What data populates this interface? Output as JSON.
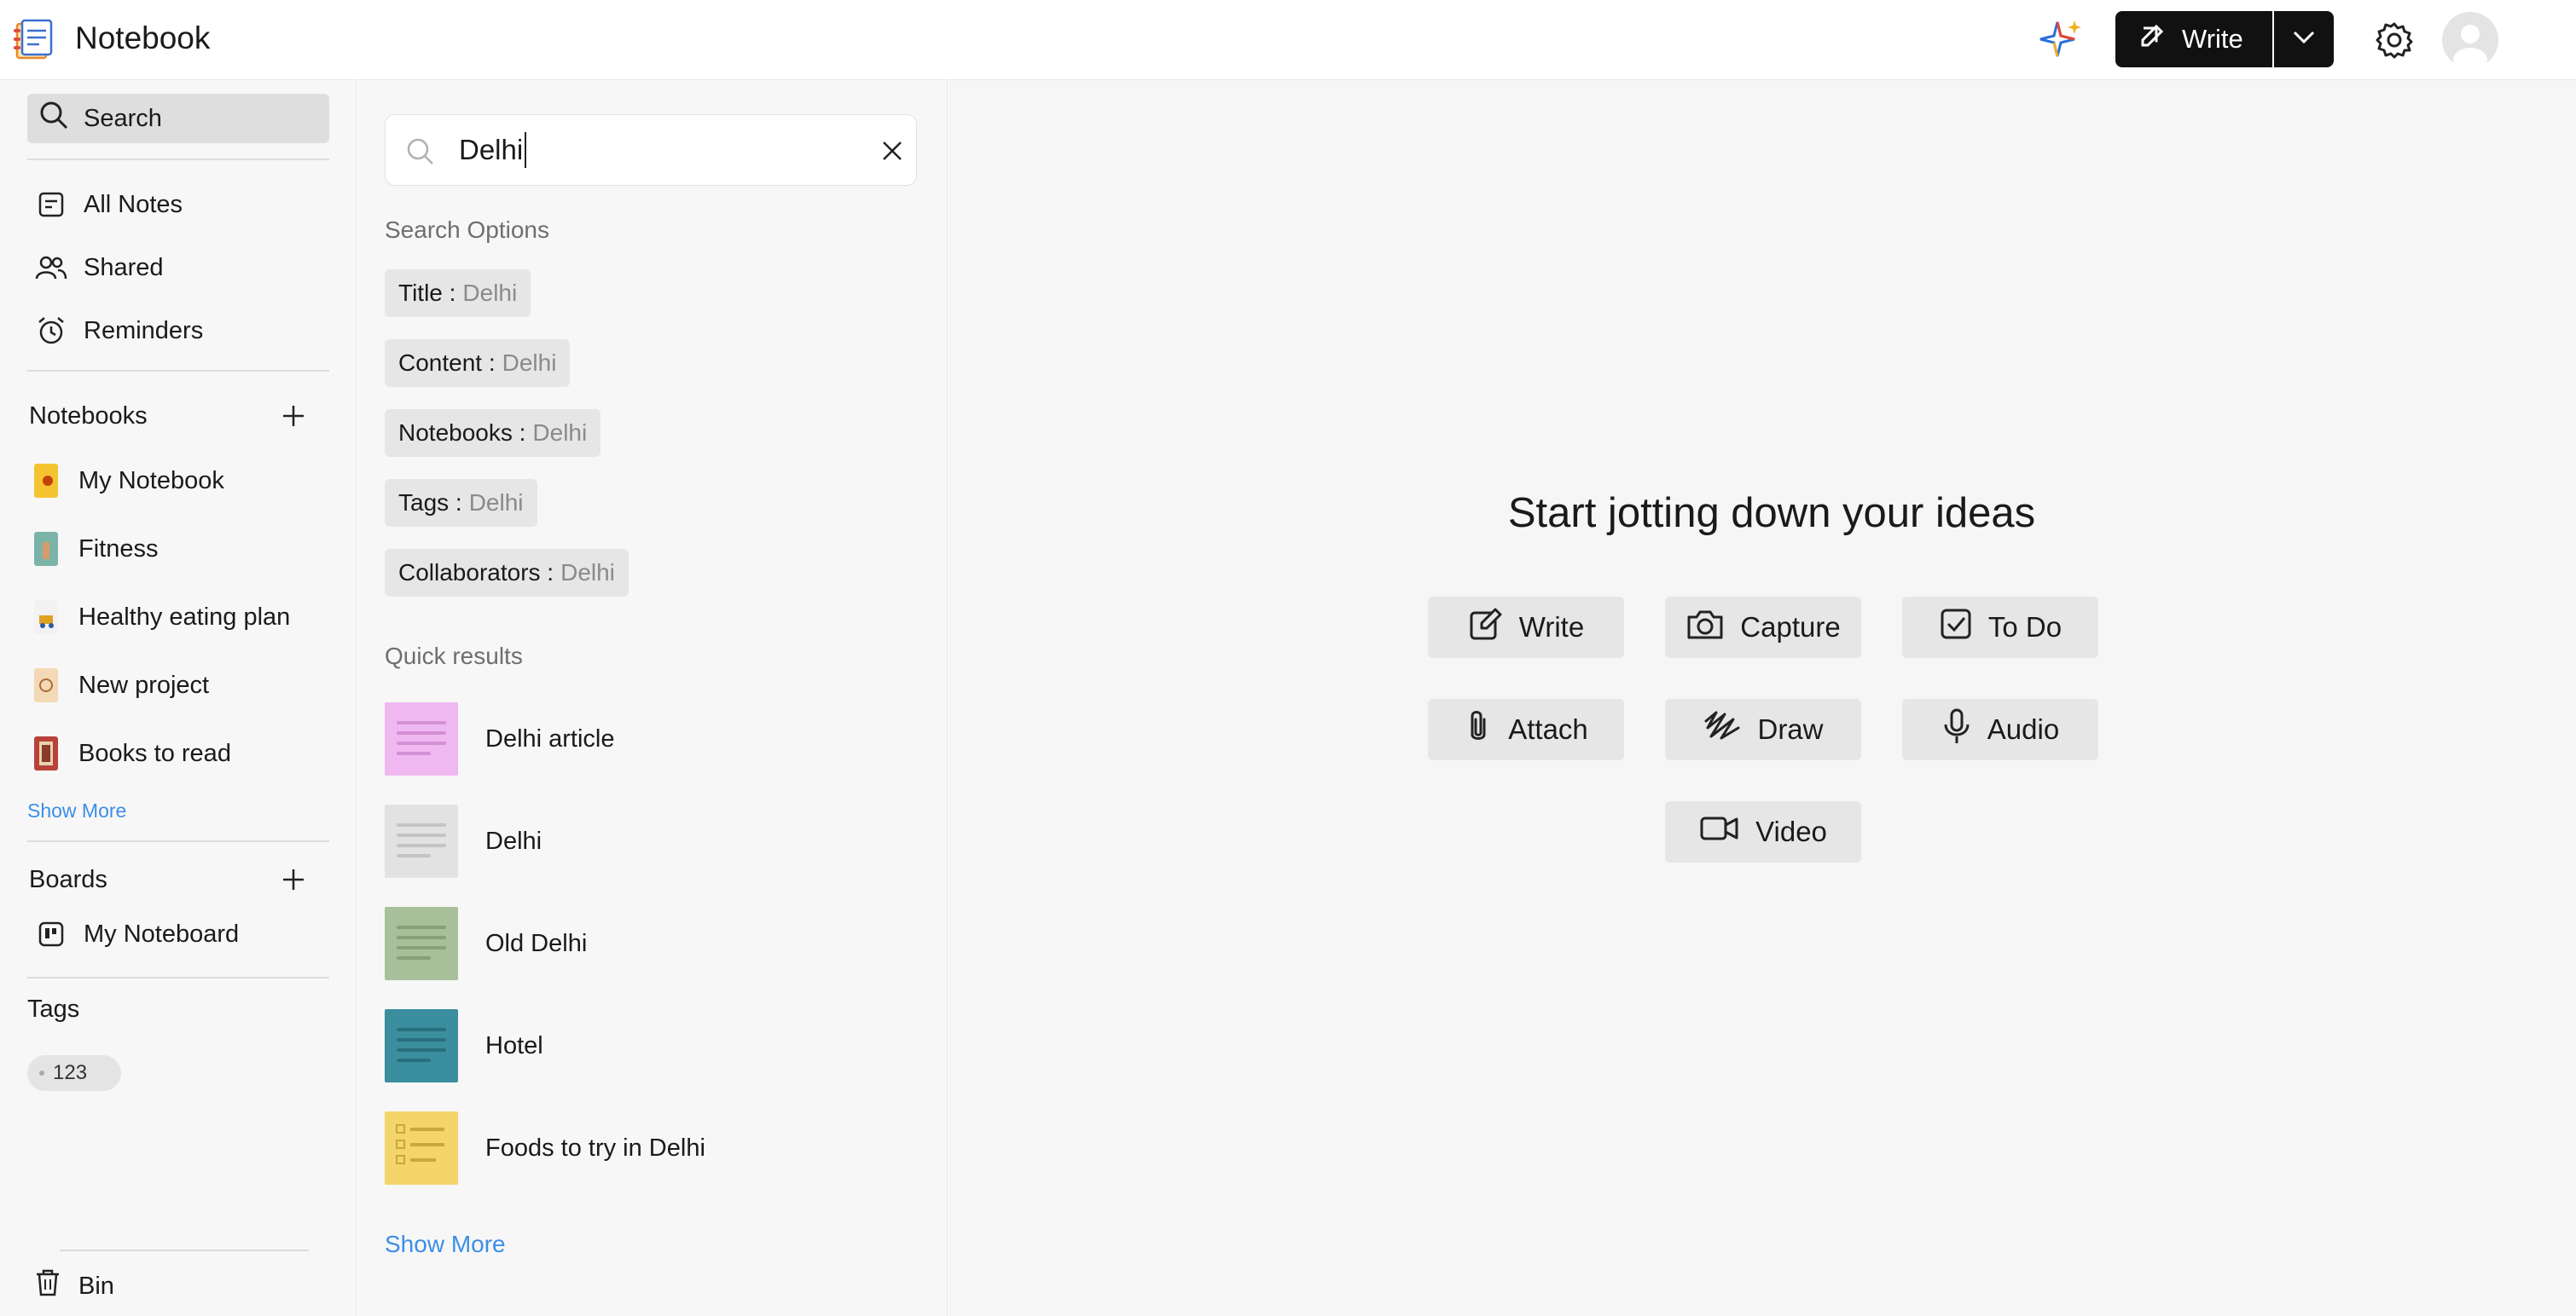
{
  "header": {
    "app_title": "Notebook",
    "write_label": "Write"
  },
  "sidebar": {
    "search_label": "Search",
    "nav": [
      {
        "label": "All Notes",
        "icon": "note-icon"
      },
      {
        "label": "Shared",
        "icon": "users-icon"
      },
      {
        "label": "Reminders",
        "icon": "alarm-clock-icon"
      }
    ],
    "notebooks_heading": "Notebooks",
    "notebooks": [
      {
        "label": "My Notebook",
        "color": "#f4c430"
      },
      {
        "label": "Fitness",
        "color": "#7bb3a8"
      },
      {
        "label": "Healthy eating plan",
        "color": "#f2f2f2"
      },
      {
        "label": "New project",
        "color": "#f3d9b5"
      },
      {
        "label": "Books to read",
        "color": "#b8423a"
      }
    ],
    "notebooks_show_more": "Show More",
    "boards_heading": "Boards",
    "boards": [
      {
        "label": "My Noteboard"
      }
    ],
    "tags_heading": "Tags",
    "tags": [
      "123"
    ],
    "bin_label": "Bin"
  },
  "search_panel": {
    "query": "Delhi",
    "options_heading": "Search Options",
    "options": [
      {
        "key": "Title :",
        "value": "Delhi"
      },
      {
        "key": "Content :",
        "value": "Delhi"
      },
      {
        "key": "Notebooks :",
        "value": "Delhi"
      },
      {
        "key": "Tags :",
        "value": "Delhi"
      },
      {
        "key": "Collaborators :",
        "value": "Delhi"
      }
    ],
    "quick_results_heading": "Quick results",
    "quick_results": [
      {
        "title": "Delhi article",
        "color": "#f0b8f0"
      },
      {
        "title": "Delhi",
        "color": "#e2e2e2"
      },
      {
        "title": "Old Delhi",
        "color": "#a8c09a"
      },
      {
        "title": "Hotel",
        "color": "#3a8e9e"
      },
      {
        "title": "Foods to try in Delhi",
        "color": "#f3d56a"
      }
    ],
    "show_more": "Show More"
  },
  "main": {
    "title": "Start jotting down your ideas",
    "actions": [
      {
        "label": "Write",
        "icon": "pencil-icon"
      },
      {
        "label": "Capture",
        "icon": "camera-icon"
      },
      {
        "label": "To Do",
        "icon": "checkbox-icon"
      },
      {
        "label": "Attach",
        "icon": "paperclip-icon"
      },
      {
        "label": "Draw",
        "icon": "scribble-icon"
      },
      {
        "label": "Audio",
        "icon": "microphone-icon"
      },
      {
        "label": "Video",
        "icon": "video-camera-icon"
      }
    ]
  }
}
